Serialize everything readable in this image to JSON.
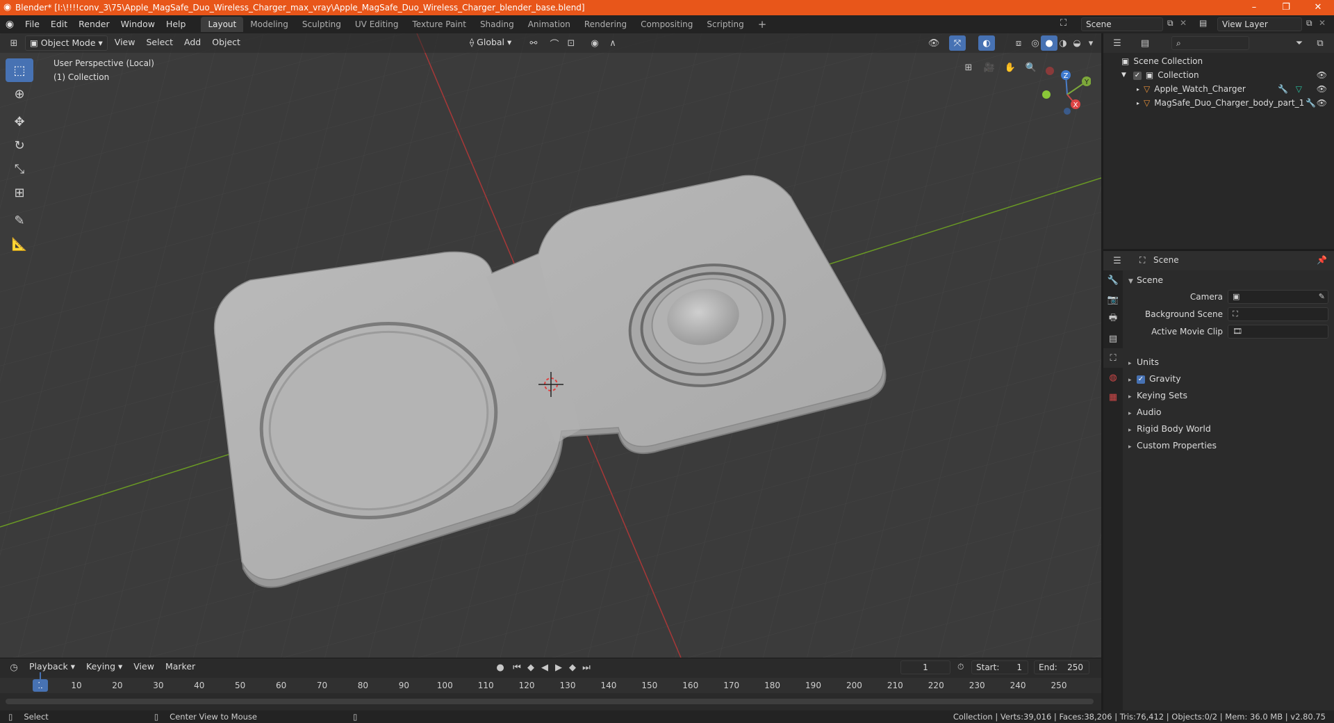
{
  "window": {
    "title": "Blender* [I:\\!!!!conv_3\\75\\Apple_MagSafe_Duo_Wireless_Charger_max_vray\\Apple_MagSafe_Duo_Wireless_Charger_blender_base.blend]",
    "minimize": "–",
    "maximize": "❐",
    "close": "✕"
  },
  "menu": {
    "items": [
      "File",
      "Edit",
      "Render",
      "Window",
      "Help"
    ],
    "workspaces": [
      "Layout",
      "Modeling",
      "Sculpting",
      "UV Editing",
      "Texture Paint",
      "Shading",
      "Animation",
      "Rendering",
      "Compositing",
      "Scripting"
    ],
    "active_workspace": "Layout",
    "add_tab": "+",
    "scene": "Scene",
    "view_layer": "View Layer"
  },
  "viewport": {
    "mode": "Object Mode",
    "menus": [
      "View",
      "Select",
      "Add",
      "Object"
    ],
    "orientation": "Global",
    "info_line1": "User Perspective (Local)",
    "info_line2": "(1) Collection",
    "gizmo": {
      "x": "X",
      "y": "Y",
      "z": "Z"
    }
  },
  "outliner": {
    "search_placeholder": "",
    "rows": [
      {
        "label": "Scene Collection"
      },
      {
        "label": "Collection"
      },
      {
        "label": "Apple_Watch_Charger"
      },
      {
        "label": "MagSafe_Duo_Charger_body_part_1"
      }
    ]
  },
  "properties": {
    "header": "Scene",
    "section": "Scene",
    "fields": [
      {
        "label": "Camera"
      },
      {
        "label": "Background Scene"
      },
      {
        "label": "Active Movie Clip"
      }
    ],
    "panels": [
      "Units",
      "Gravity",
      "Keying Sets",
      "Audio",
      "Rigid Body World",
      "Custom Properties"
    ]
  },
  "timeline": {
    "menus": [
      "Playback",
      "Keying",
      "View",
      "Marker"
    ],
    "current_frame": "1",
    "start_label": "Start:",
    "start": "1",
    "end_label": "End:",
    "end": "250",
    "ticks": [
      "1",
      "10",
      "20",
      "30",
      "40",
      "50",
      "60",
      "70",
      "80",
      "90",
      "100",
      "110",
      "120",
      "130",
      "140",
      "150",
      "160",
      "170",
      "180",
      "190",
      "200",
      "210",
      "220",
      "230",
      "240",
      "250"
    ]
  },
  "status": {
    "left1": "Select",
    "left2": "Center View to Mouse",
    "right": "Collection | Verts:39,016 | Faces:38,206 | Tris:76,412 | Objects:0/2 | Mem: 36.0 MB | v2.80.75"
  }
}
